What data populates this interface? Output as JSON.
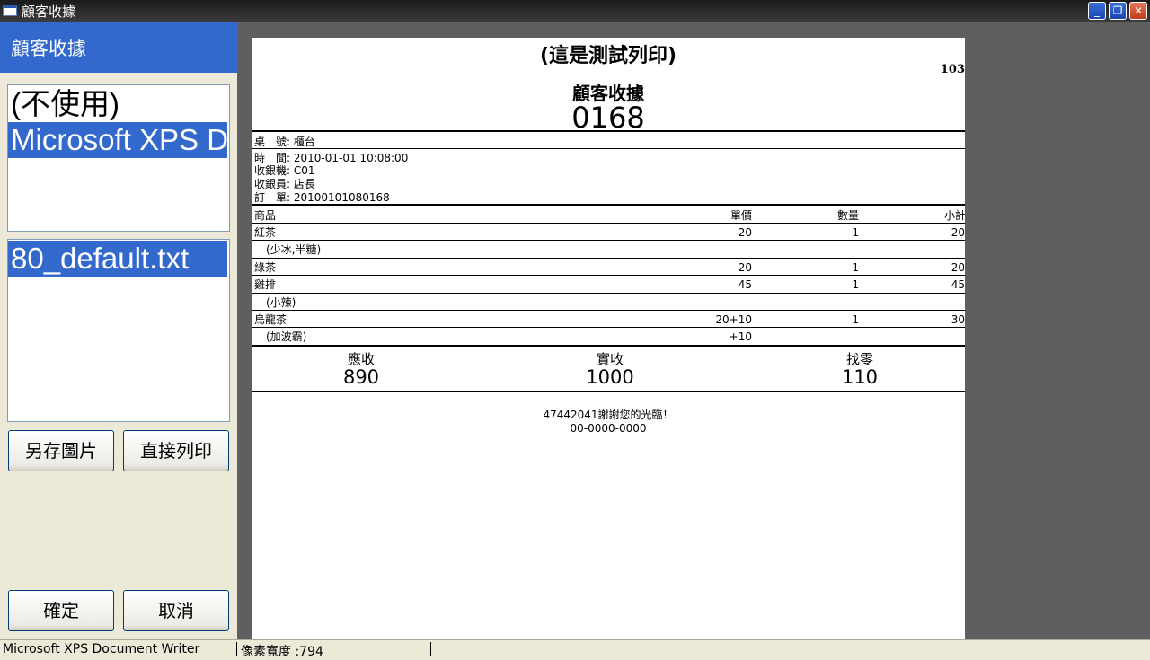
{
  "window": {
    "title": "顧客收據"
  },
  "panel": {
    "header": "顧客收據"
  },
  "printers": {
    "items": [
      "(不使用)",
      "Microsoft XPS D"
    ]
  },
  "templates": {
    "items": [
      "80_default.txt"
    ]
  },
  "buttons": {
    "save_image": "另存圖片",
    "print_direct": "直接列印",
    "ok": "確定",
    "cancel": "取消"
  },
  "receipt": {
    "test_title": "(這是測試列印)",
    "corner_number": "103",
    "heading": "顧客收據",
    "number": "0168",
    "info": [
      {
        "label": "桌　號:",
        "value": "櫃台"
      },
      {
        "label": "時　間:",
        "value": "2010-01-01 10:08:00"
      },
      {
        "label": "收銀機:",
        "value": "C01"
      },
      {
        "label": "收銀員:",
        "value": "店長"
      },
      {
        "label": "訂　單:",
        "value": "20100101080168"
      }
    ],
    "columns": {
      "item": "商品",
      "price": "單價",
      "qty": "數量",
      "subtotal": "小計"
    },
    "rows": [
      {
        "item": "紅茶",
        "price": "20",
        "qty": "1",
        "subtotal": "20"
      },
      {
        "note": "(少冰,半糖)"
      },
      {
        "item": "綠茶",
        "price": "20",
        "qty": "1",
        "subtotal": "20"
      },
      {
        "item": "雞排",
        "price": "45",
        "qty": "1",
        "subtotal": "45"
      },
      {
        "note": "(小辣)"
      },
      {
        "item": "烏龍茶",
        "price": "20+10",
        "qty": "1",
        "subtotal": "30"
      },
      {
        "note": "(加波霸)",
        "price": "+10"
      }
    ],
    "totals": {
      "due_label": "應收",
      "due_value": "890",
      "paid_label": "實收",
      "paid_value": "1000",
      "change_label": "找零",
      "change_value": "110"
    },
    "footer_line1": "47442041謝謝您的光臨！",
    "footer_line2": "00-0000-0000"
  },
  "status": {
    "printer": "Microsoft XPS Document Writer",
    "width": "像素寬度 :794"
  }
}
